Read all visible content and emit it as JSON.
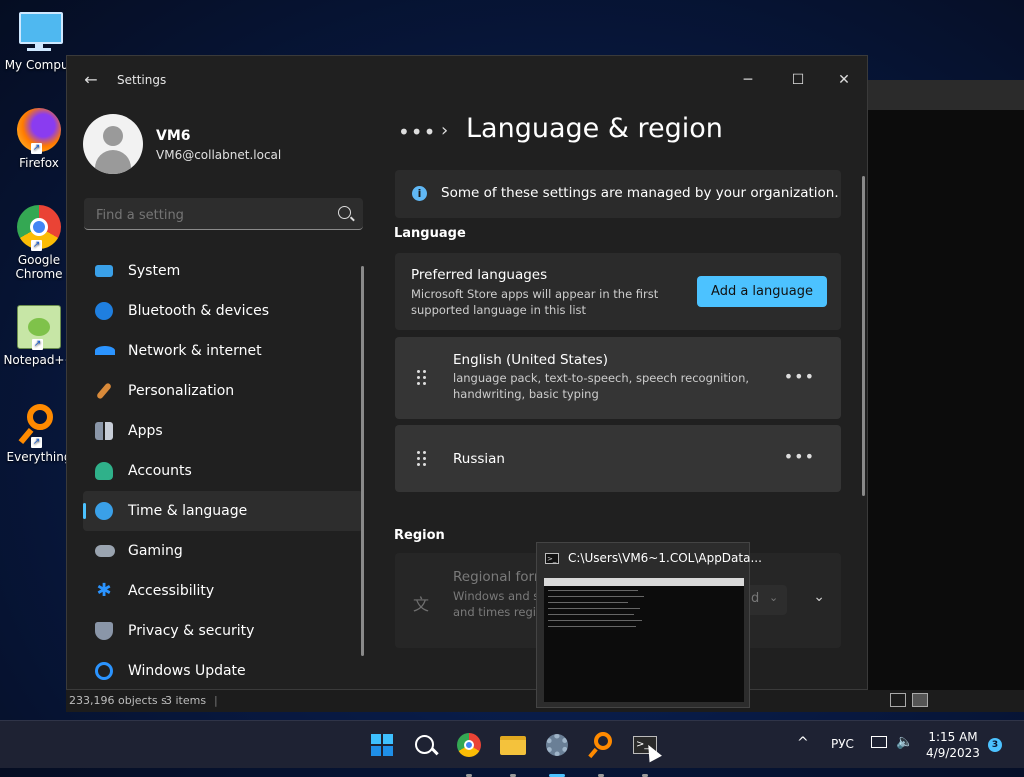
{
  "desktop": {
    "icons": [
      {
        "label": "My Comput",
        "icon": "monitor-icon"
      },
      {
        "label": "Firefox",
        "icon": "firefox-icon"
      },
      {
        "label": "Google Chrome",
        "icon": "chrome-icon"
      },
      {
        "label": "Notepad++",
        "icon": "notepad-plus-plus-icon"
      },
      {
        "label": "Everything",
        "icon": "everything-search-icon"
      }
    ]
  },
  "explorer_status": {
    "objects": "233,196 objects s",
    "items": "3 items"
  },
  "settings": {
    "title": "Settings",
    "profile": {
      "name": "VM6",
      "email": "VM6@collabnet.local"
    },
    "search": {
      "placeholder": "Find a setting"
    },
    "nav": [
      {
        "label": "System",
        "icon": "system-icon",
        "color": "#3aa0e8"
      },
      {
        "label": "Bluetooth & devices",
        "icon": "bluetooth-icon",
        "color": "#1f7fe0"
      },
      {
        "label": "Network & internet",
        "icon": "wifi-icon",
        "color": "#2b94ff"
      },
      {
        "label": "Personalization",
        "icon": "brush-icon",
        "color": "#d98a3a"
      },
      {
        "label": "Apps",
        "icon": "apps-icon",
        "color": "#8a96a8"
      },
      {
        "label": "Accounts",
        "icon": "person-icon",
        "color": "#2fb18a"
      },
      {
        "label": "Time & language",
        "icon": "globe-clock-icon",
        "color": "#3aa0e8",
        "active": true
      },
      {
        "label": "Gaming",
        "icon": "gamepad-icon",
        "color": "#9aa4b0"
      },
      {
        "label": "Accessibility",
        "icon": "accessibility-icon",
        "color": "#2b94ff"
      },
      {
        "label": "Privacy & security",
        "icon": "shield-icon",
        "color": "#8a96a8"
      },
      {
        "label": "Windows Update",
        "icon": "update-icon",
        "color": "#2b94ff"
      }
    ],
    "breadcrumb": {
      "dots": "•••",
      "chevron": "›"
    },
    "page_title": "Language & region",
    "info_banner": "Some of these settings are managed by your organization.",
    "language_section": "Language",
    "preferred": {
      "title": "Preferred languages",
      "description": "Microsoft Store apps will appear in the first supported language in this list",
      "add_button": "Add a language"
    },
    "languages": [
      {
        "name": "English (United States)",
        "features": "language pack, text-to-speech, speech recognition, handwriting, basic typing"
      },
      {
        "name": "Russian",
        "features": ""
      }
    ],
    "region_section": "Region",
    "regional_format": {
      "title": "Regional form",
      "description": "Windows and so dates and times regional format",
      "value": "d"
    },
    "more_label": "•••"
  },
  "taskbar_thumbnail": {
    "title": "C:\\Users\\VM6~1.COL\\AppData..."
  },
  "taskbar": {
    "apps": [
      {
        "name": "start-button",
        "icon": "windows-logo-icon"
      },
      {
        "name": "search-button",
        "icon": "search-icon"
      },
      {
        "name": "chrome-taskbar",
        "icon": "chrome-icon"
      },
      {
        "name": "file-explorer-taskbar",
        "icon": "folder-icon"
      },
      {
        "name": "settings-taskbar",
        "icon": "gear-icon"
      },
      {
        "name": "everything-taskbar",
        "icon": "everything-search-icon"
      },
      {
        "name": "terminal-taskbar",
        "icon": "terminal-icon"
      }
    ],
    "tray": {
      "chevron": "^",
      "lang": "РУС"
    },
    "clock": {
      "time": "1:15 AM",
      "date": "4/9/2023"
    },
    "notifications": "3"
  }
}
